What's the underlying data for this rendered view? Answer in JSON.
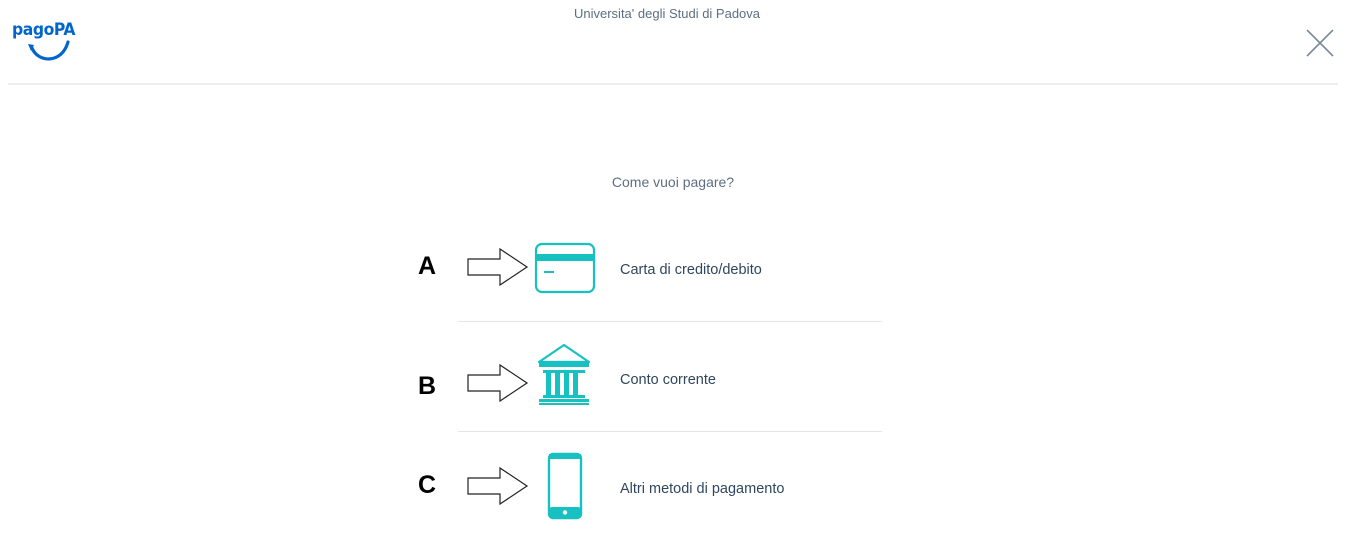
{
  "header": {
    "logo_text": "pagoPA",
    "org_name": "Universita' degli Studi di Padova",
    "close_icon": "close-icon"
  },
  "main": {
    "question": "Come vuoi pagare?",
    "methods": [
      {
        "marker": "A",
        "label": "Carta di credito/debito",
        "icon": "credit-card-icon"
      },
      {
        "marker": "B",
        "label": "Conto corrente",
        "icon": "bank-icon"
      },
      {
        "marker": "C",
        "label": "Altri metodi di pagamento",
        "icon": "smartphone-icon"
      }
    ]
  },
  "colors": {
    "accent": "#17c1c1",
    "brand": "#0066cc",
    "text": "#2f475e",
    "muted": "#5c6f82"
  }
}
